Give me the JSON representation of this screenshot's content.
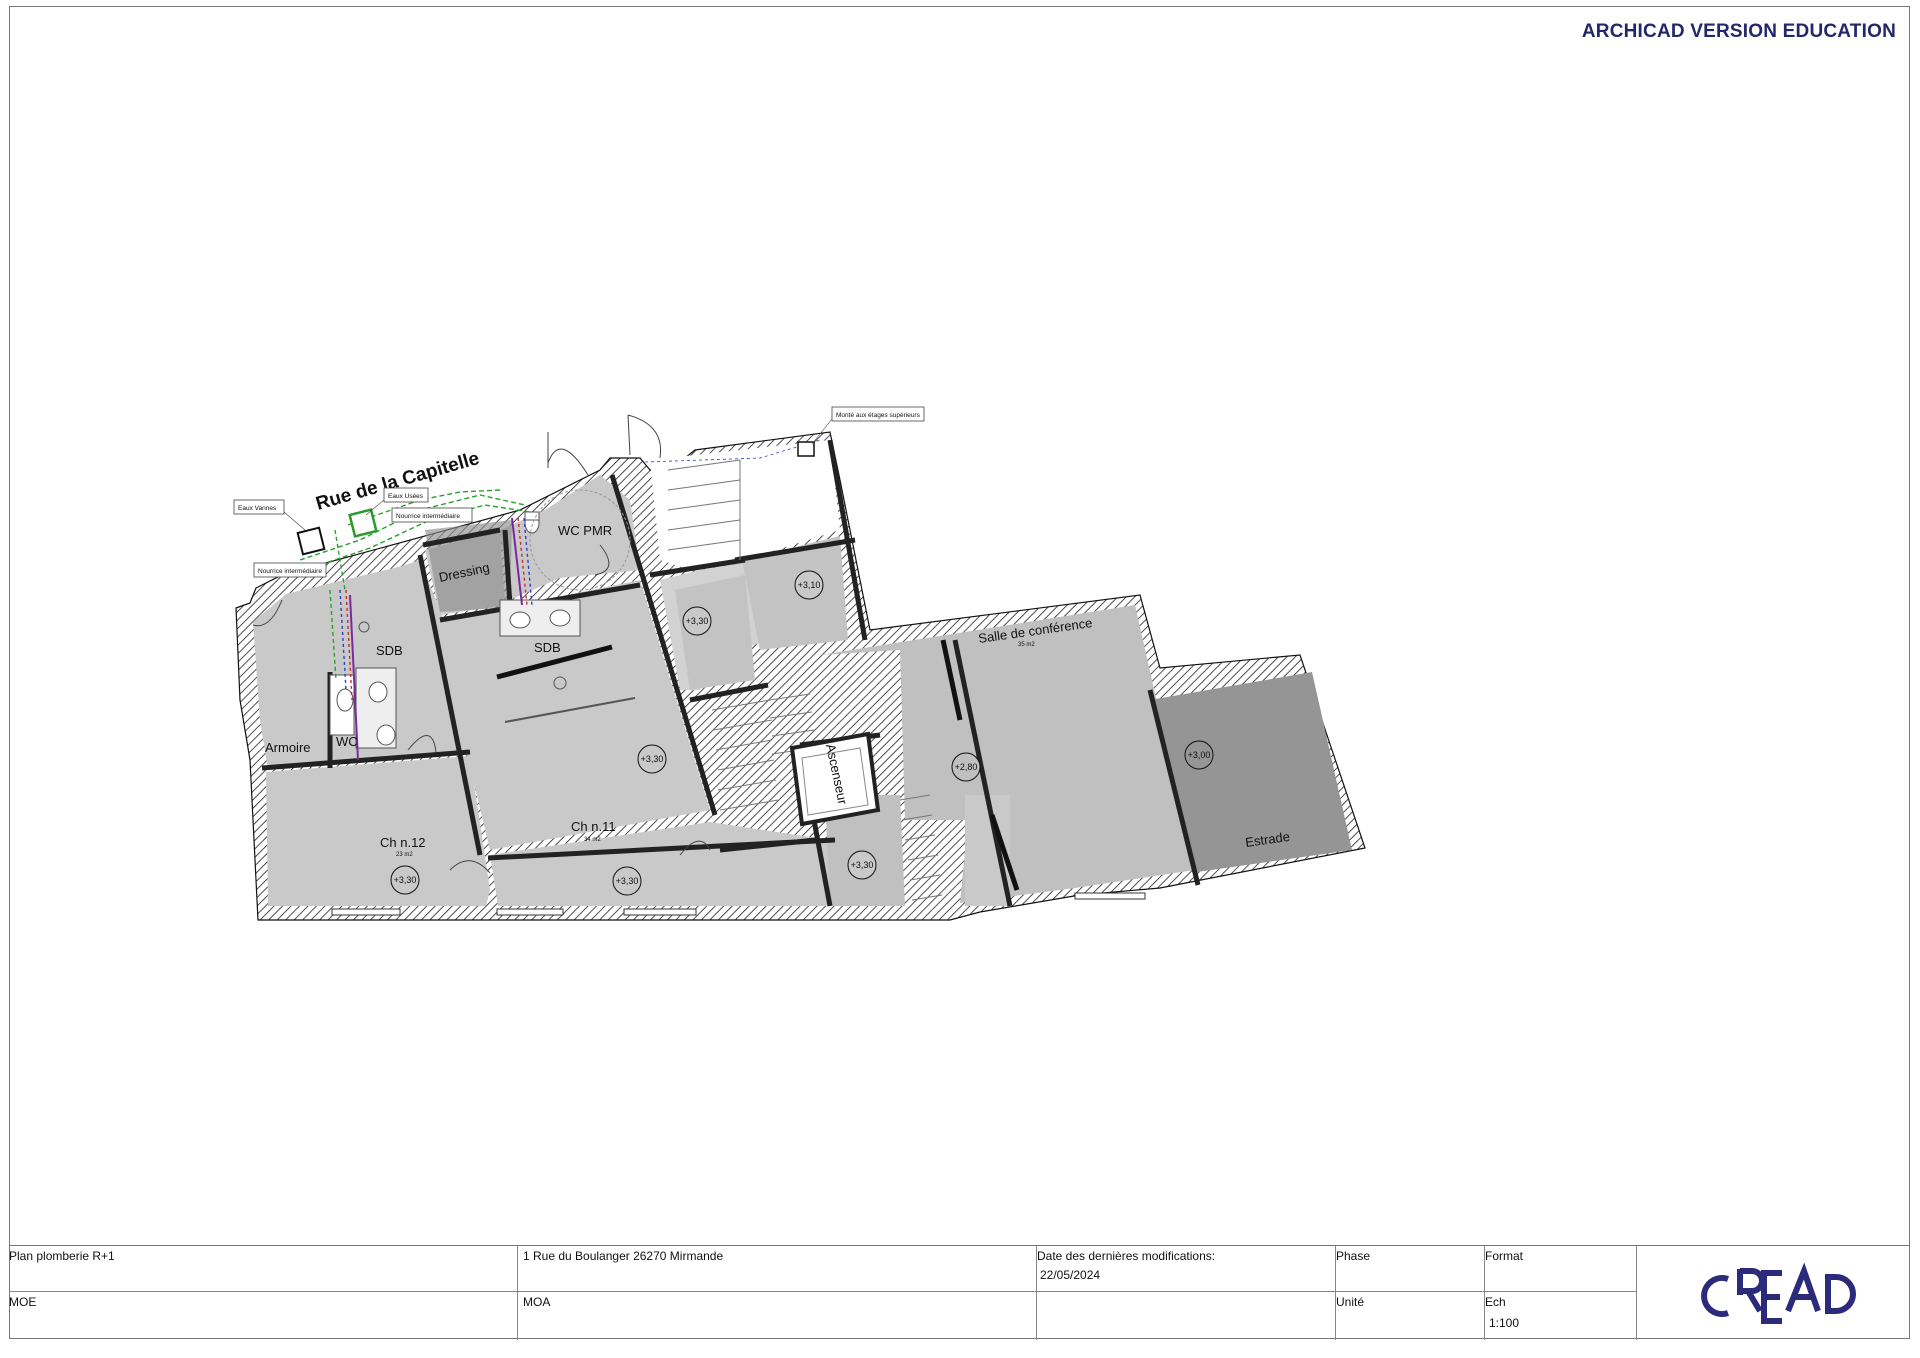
{
  "watermark": "ARCHICAD VERSION EDUCATION",
  "street_label": "Rue de la Capitelle",
  "callouts": {
    "eaux_vannes": "Eaux Vannes",
    "eaux_usees": "Eaux Usées",
    "nourrice_1": "Nourrice intermédiaire",
    "nourrice_2": "Nourrice intermédiaire",
    "monte": "Monté aux étages supérieurs"
  },
  "rooms": {
    "sdb_left": "SDB",
    "armoire": "Armoire",
    "wc": "WC",
    "ch12": "Ch n.12",
    "ch12_area": "23 m2",
    "dressing": "Dressing",
    "wc_pmr": "WC PMR",
    "sdb_mid": "SDB",
    "ch11": "Ch n.11",
    "ch11_area": "34 m2",
    "ascenseur": "Ascenseur",
    "salle": "Salle de conférence",
    "salle_area": "35 m2",
    "estrade": "Estrade"
  },
  "levels": {
    "l1": "+3,30",
    "l2": "+3,10",
    "l3": "+3,30",
    "l4": "+2,80",
    "l5": "+3,00",
    "l6": "+3,30",
    "l7": "+3,30",
    "l8": "+3,30"
  },
  "title_block": {
    "plan_title": "Plan plomberie R+1",
    "address": "1 Rue du Boulanger 26270 Mirmande",
    "date_label": "Date des dernières modifications:",
    "date_value": "22/05/2024",
    "phase_label": "Phase",
    "format_label": "Format",
    "moe_label": "MOE",
    "moa_label": "MOA",
    "unite_label": "Unité",
    "ech_label": "Ech",
    "ech_value": "1:100",
    "logo_text": "CREAD"
  },
  "colors": {
    "watermark": "#24286b",
    "logo": "#2c2a7a",
    "floor_light": "#c9c9c9",
    "floor_dark": "#9a9a9a",
    "wall": "#222222",
    "pipe_green": "#2aa02a",
    "pipe_blue": "#3040c0",
    "pipe_red": "#c03030"
  }
}
